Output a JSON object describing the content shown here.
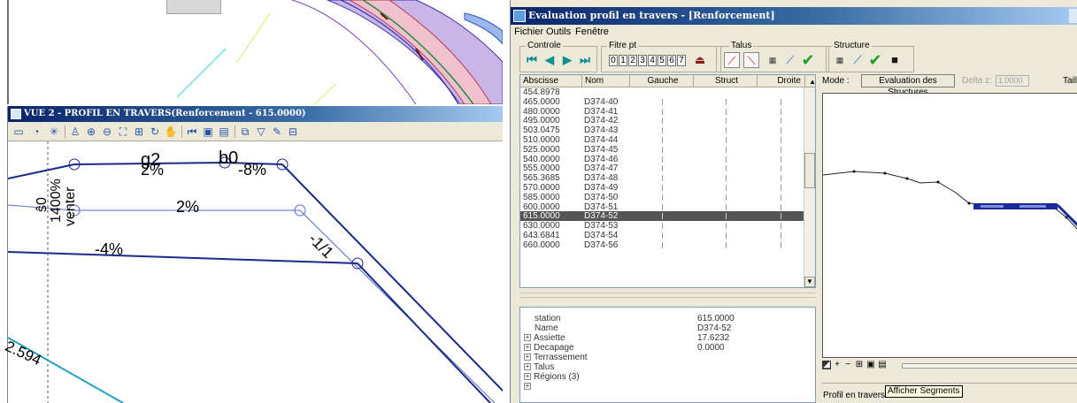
{
  "view2": {
    "title": "VUE 2 - PROFIL EN TRAVERS(Renforcement - 615.0000)",
    "toolbar_icons": [
      "display-mode-icon",
      "view-attributes-icon",
      "lights-icon",
      "brush-icon",
      "zoom-in-icon",
      "zoom-out-icon",
      "fit-view-icon",
      "window-area-icon",
      "rotate-view-icon",
      "pan-icon",
      "view-previous-icon",
      "view-next-icon",
      "copy-view-icon",
      "clip-volume-icon",
      "camera-icon",
      "render-icon",
      "levels-icon"
    ],
    "annotations": {
      "g2": "g2",
      "b0": "b0",
      "slope_2_top": "2%",
      "slope_8": "-8%",
      "slope_2_mid": "2%",
      "slope_4": "-4%",
      "ratio": "-1/1",
      "vertical_labels": [
        "ŝ0",
        "1400%",
        "venter"
      ],
      "value_bottom": "2.594"
    }
  },
  "window": {
    "title": "Evaluation profil en travers - [Renforcement]",
    "menu": [
      "Fichier",
      "Outils",
      "Fenêtre"
    ],
    "groups": {
      "controle": "Controle",
      "filtre": "Fitre pt",
      "talus": "Talus",
      "structure": "Structure"
    },
    "filter_digits": [
      "0",
      "1",
      "2",
      "3",
      "4",
      "5",
      "6",
      "7"
    ],
    "list": {
      "columns": [
        "Abscisse",
        "Nom",
        "Gauche",
        "Struct",
        "Droite"
      ],
      "rows": [
        {
          "abscisse": "454.8978",
          "nom": ""
        },
        {
          "abscisse": "465.0000",
          "nom": "D374-40"
        },
        {
          "abscisse": "480.0000",
          "nom": "D374-41"
        },
        {
          "abscisse": "495.0000",
          "nom": "D374-42"
        },
        {
          "abscisse": "503.0475",
          "nom": "D374-43"
        },
        {
          "abscisse": "510.0000",
          "nom": "D374-44"
        },
        {
          "abscisse": "525.0000",
          "nom": "D374-45"
        },
        {
          "abscisse": "540.0000",
          "nom": "D374-46"
        },
        {
          "abscisse": "555.0000",
          "nom": "D374-47"
        },
        {
          "abscisse": "565.3685",
          "nom": "D374-48"
        },
        {
          "abscisse": "570.0000",
          "nom": "D374-49"
        },
        {
          "abscisse": "585.0000",
          "nom": "D374-50"
        },
        {
          "abscisse": "600.0000",
          "nom": "D374-51"
        },
        {
          "abscisse": "615.0000",
          "nom": "D374-52"
        },
        {
          "abscisse": "630.0000",
          "nom": "D374-53"
        },
        {
          "abscisse": "643.6841",
          "nom": "D374-54"
        },
        {
          "abscisse": "660.0000",
          "nom": "D374-56"
        }
      ],
      "selected_index": 13
    },
    "properties": [
      {
        "key": "station",
        "value": "615.0000",
        "expandable": false
      },
      {
        "key": "Name",
        "value": "D374-52",
        "expandable": false
      },
      {
        "key": "Assiette",
        "value": "17.6232",
        "expandable": true
      },
      {
        "key": "Decapage",
        "value": "0.0000",
        "expandable": true
      },
      {
        "key": "Terrassement",
        "value": "",
        "expandable": true
      },
      {
        "key": "Talus",
        "value": "",
        "expandable": true
      },
      {
        "key": "Régions (3)",
        "value": "",
        "expandable": true
      },
      {
        "key": "",
        "value": "",
        "expandable": true
      }
    ],
    "mode": {
      "label": "Mode :",
      "button": "Evaluation des Structures",
      "delta_label": "Delta z:",
      "delta_value": "1.0000",
      "taille_label": "Taill"
    },
    "status": {
      "text": "Profil en travers d",
      "tooltip": "Afficher Segments"
    }
  }
}
